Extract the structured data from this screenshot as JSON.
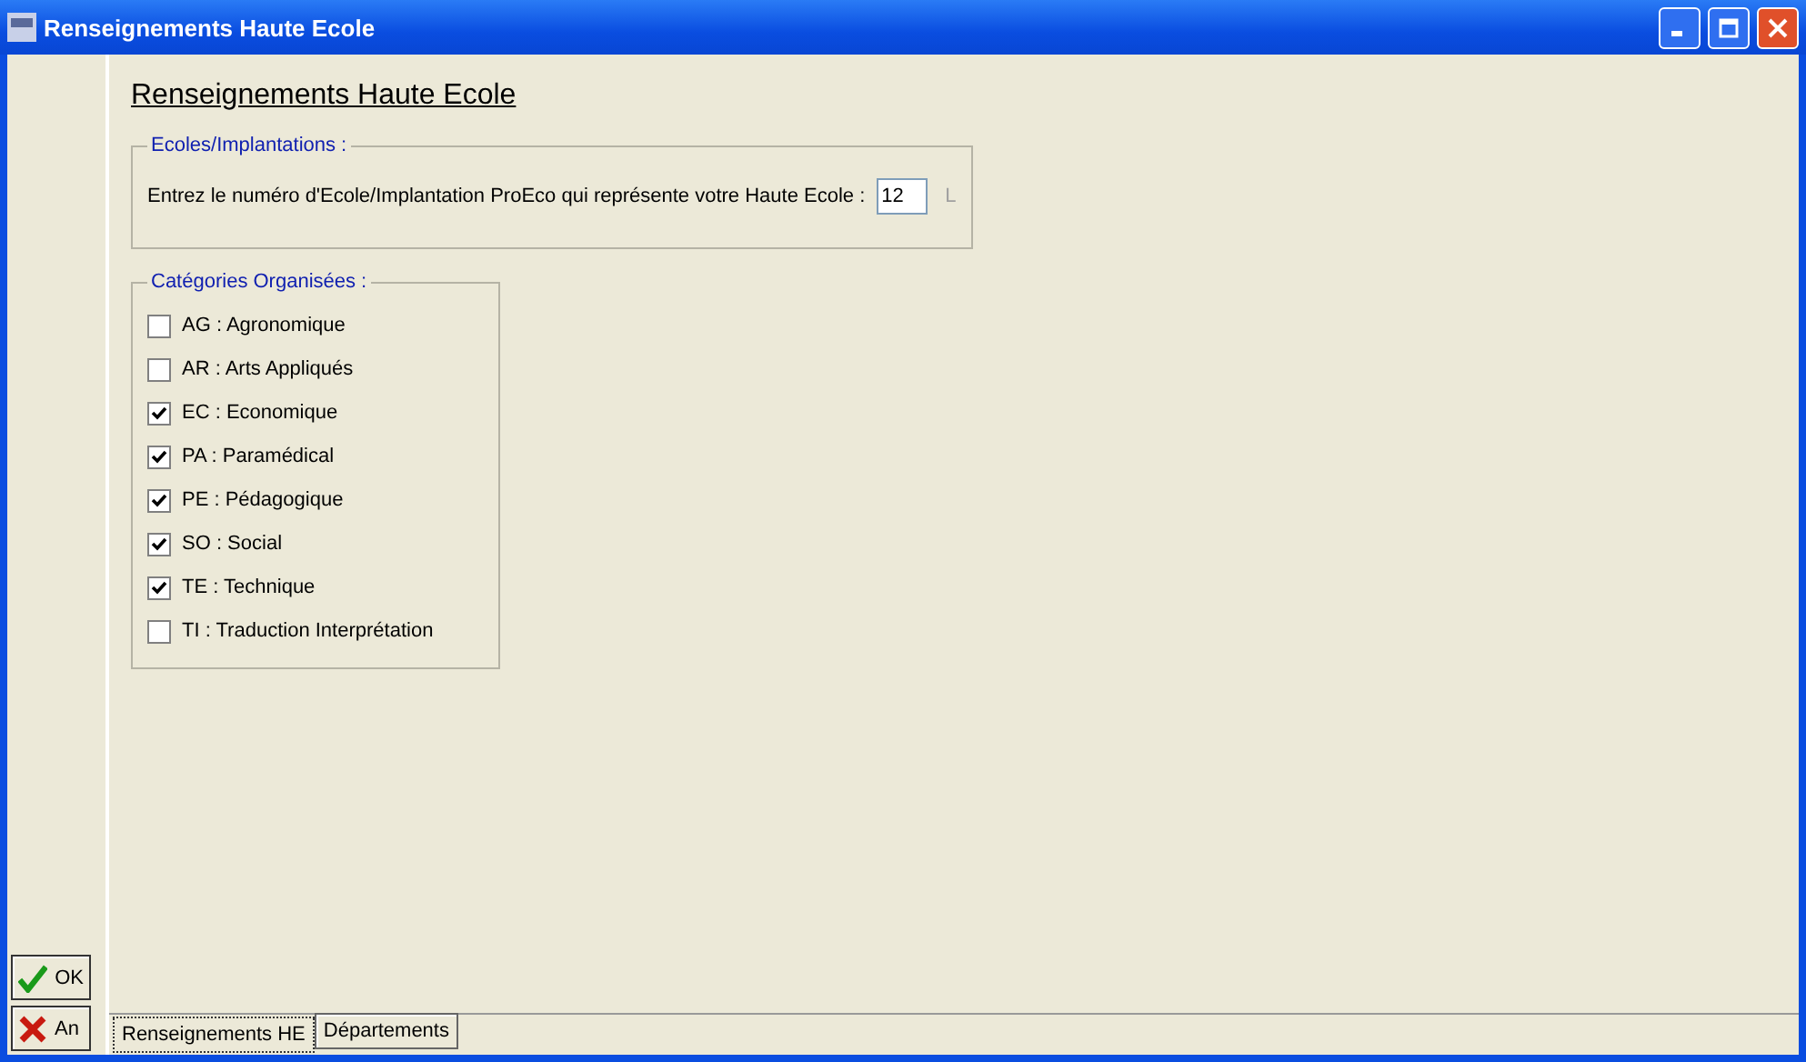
{
  "window": {
    "title": "Renseignements Haute Ecole"
  },
  "heading": "Renseignements Haute Ecole",
  "schools": {
    "legend": "Ecoles/Implantations :",
    "prompt": "Entrez le numéro d'Ecole/Implantation ProEco qui représente votre Haute Ecole :",
    "value": "12",
    "suffix": "L"
  },
  "categories": {
    "legend": "Catégories Organisées :",
    "items": [
      {
        "label": "AG : Agronomique",
        "checked": false
      },
      {
        "label": "AR : Arts Appliqués",
        "checked": false
      },
      {
        "label": "EC : Economique",
        "checked": true
      },
      {
        "label": "PA : Paramédical",
        "checked": true
      },
      {
        "label": "PE : Pédagogique",
        "checked": true
      },
      {
        "label": "SO : Social",
        "checked": true
      },
      {
        "label": "TE : Technique",
        "checked": true
      },
      {
        "label": "TI : Traduction Interprétation",
        "checked": false
      }
    ]
  },
  "buttons": [
    {
      "kind": "ok",
      "label": "OK"
    },
    {
      "kind": "cancel",
      "label": "An"
    }
  ],
  "tabs": [
    {
      "label": "Renseignements HE",
      "selected": true
    },
    {
      "label": "Départements",
      "selected": false
    }
  ]
}
